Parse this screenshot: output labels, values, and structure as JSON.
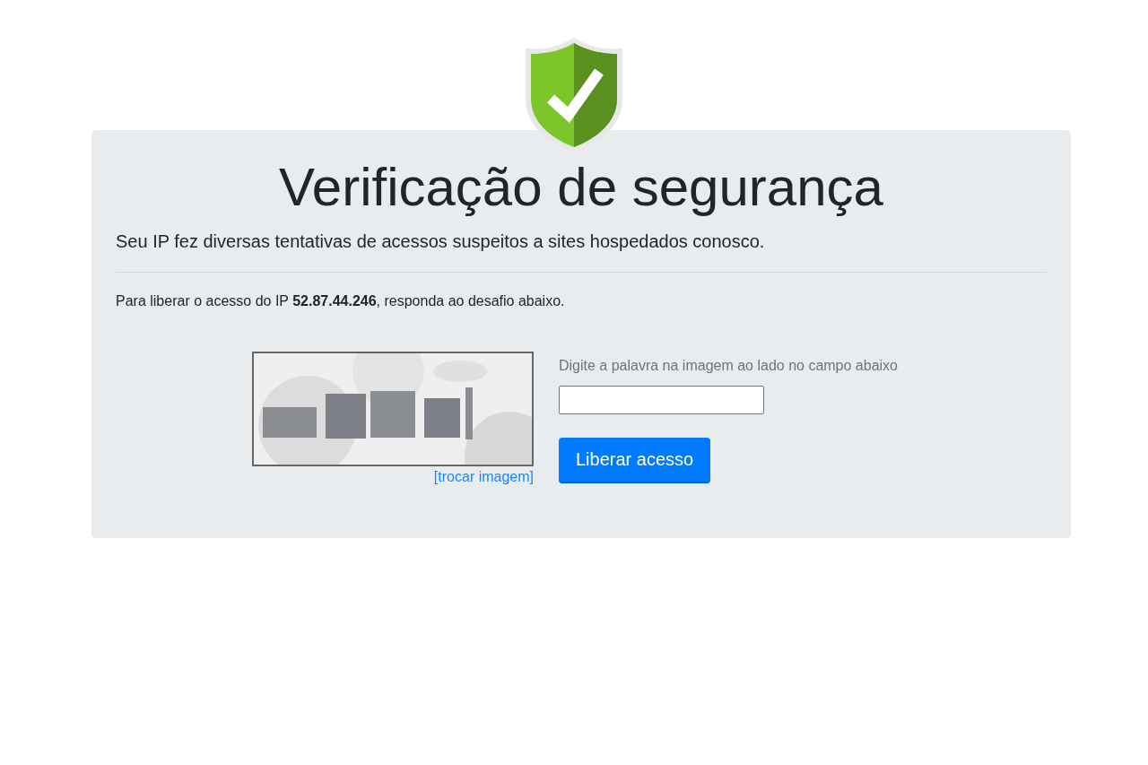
{
  "title": "Verificação de segurança",
  "lead": "Seu IP fez diversas tentativas de acessos suspeitos a sites hospedados conosco.",
  "instruction": "Para liberar o acesso do IP **52.87.44.246**, responda ao desafio abaixo.",
  "captcha": {
    "kind": "picture",
    "change_link": "[trocar imagem]"
  },
  "form": {
    "hint": "Digite a palavra na imagem ao lado no campo abaixo",
    "submit": "Liberar acesso"
  }
}
